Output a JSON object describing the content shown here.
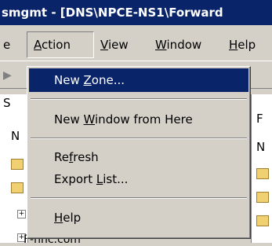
{
  "window": {
    "title": "smgmt - [DNS\\NPCE-NS1\\Forward"
  },
  "menubar": {
    "file_fragment": "e",
    "action": {
      "prefix": "",
      "mnemonic": "A",
      "suffix": "ction"
    },
    "view": {
      "prefix": "",
      "mnemonic": "V",
      "suffix": "iew"
    },
    "window": {
      "prefix": "",
      "mnemonic": "W",
      "suffix": "indow"
    },
    "help": {
      "prefix": "",
      "mnemonic": "H",
      "suffix": "elp"
    }
  },
  "left_pane": {
    "header_fragment": "S",
    "row_fragment": "N",
    "bottom_fragment": "F-nnc.com"
  },
  "right_pane": {
    "header_fragment": "F",
    "col_fragment": "N"
  },
  "action_menu": {
    "new_zone": {
      "prefix": "New ",
      "mnemonic": "Z",
      "suffix": "one..."
    },
    "new_window": {
      "prefix": "New ",
      "mnemonic": "W",
      "suffix": "indow from Here"
    },
    "refresh": {
      "prefix": "Re",
      "mnemonic": "f",
      "suffix": "resh"
    },
    "export_list": {
      "prefix": "Export ",
      "mnemonic": "L",
      "suffix": "ist..."
    },
    "help": {
      "prefix": "",
      "mnemonic": "H",
      "suffix": "elp"
    }
  },
  "colors": {
    "selection": "#0a246a",
    "face": "#d4d0c8"
  }
}
